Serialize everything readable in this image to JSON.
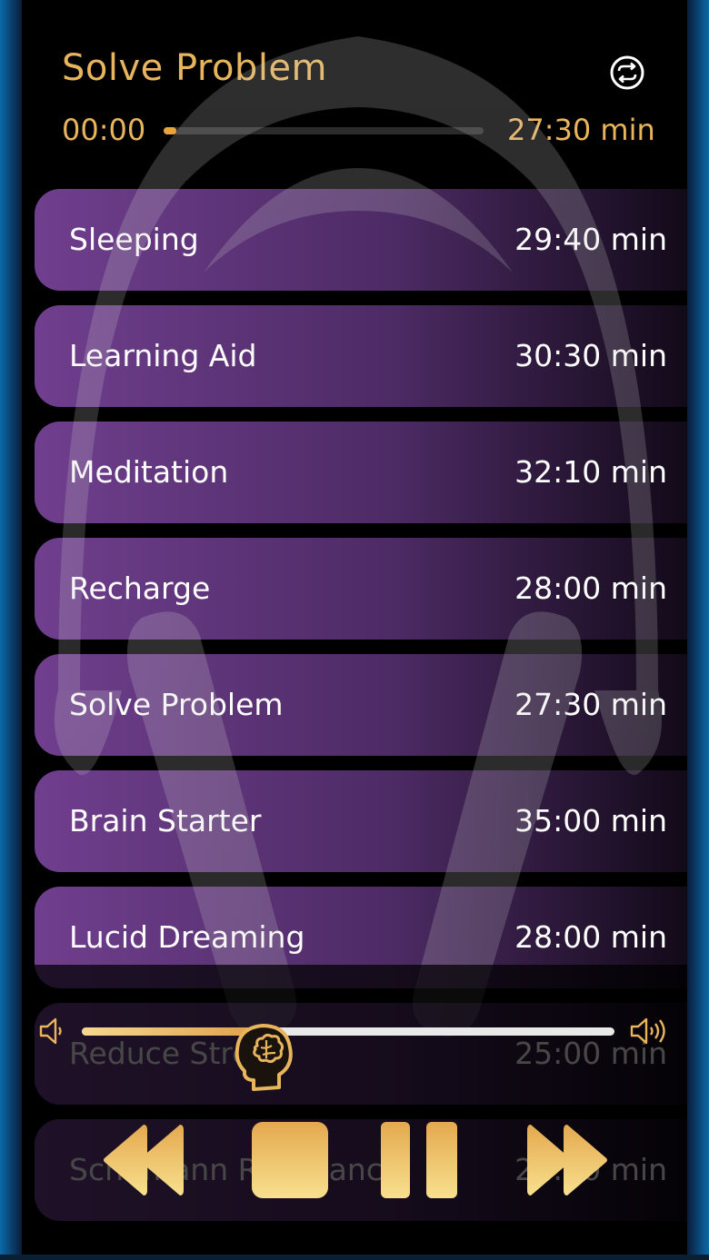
{
  "player": {
    "title": "Solve Problem",
    "current_time": "00:00",
    "total_time": "27:30 min",
    "progress": 0.04,
    "volume": 0.33
  },
  "tracks": [
    {
      "name": "Sleeping",
      "duration": "29:40 min"
    },
    {
      "name": "Learning Aid",
      "duration": "30:30 min"
    },
    {
      "name": "Meditation",
      "duration": "32:10 min"
    },
    {
      "name": "Recharge",
      "duration": "28:00 min"
    },
    {
      "name": "Solve Problem",
      "duration": "27:30 min"
    },
    {
      "name": "Brain Starter",
      "duration": "35:00 min"
    },
    {
      "name": "Lucid Dreaming",
      "duration": "28:00 min"
    },
    {
      "name": "Reduce Stress",
      "duration": "25:00 min"
    },
    {
      "name": "Schumann Resonance",
      "duration": "22:00 min"
    }
  ],
  "icons": {
    "repeat": "repeat-icon",
    "volume_low": "volume-low-icon",
    "volume_high": "volume-high-icon",
    "knob": "brain-head-icon",
    "rewind": "rewind-icon",
    "stop": "stop-icon",
    "pause": "pause-icon",
    "forward": "fast-forward-icon"
  },
  "colors": {
    "accent": "#e8b45c",
    "track_bg": "#764296",
    "frame_glow": "#0a6aa8"
  }
}
